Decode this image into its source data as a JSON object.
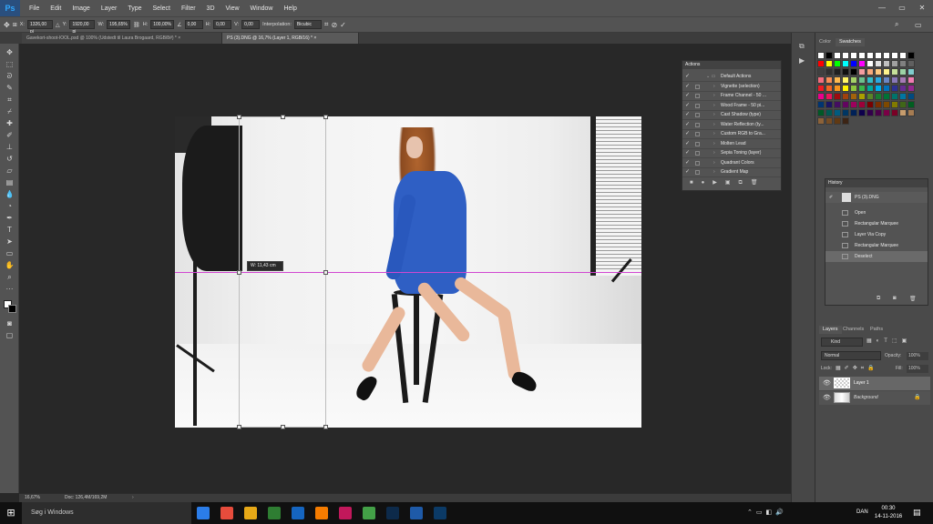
{
  "app": {
    "logo": "Ps"
  },
  "menu": [
    "File",
    "Edit",
    "Image",
    "Layer",
    "Type",
    "Select",
    "Filter",
    "3D",
    "View",
    "Window",
    "Help"
  ],
  "window_controls": [
    "—",
    "▭",
    "✕"
  ],
  "options": {
    "x_label": "X:",
    "x_value": "1326,00 pi",
    "y_label": "Y:",
    "y_value": "1920,00 pi",
    "w_label": "W:",
    "w_value": "195,65%",
    "h_label": "H:",
    "h_value": "100,00%",
    "angle_value": "0,00",
    "hskew_label": "H:",
    "hskew_value": "0,00",
    "vskew_label": "V:",
    "vskew_value": "0,00",
    "interp_label": "Interpolation:",
    "interp_value": "Bicubic"
  },
  "tabs": [
    {
      "label": "Gavekort-shoot-IOOL.psd @ 100% (Udstedt til Laura Brogaard, RGB/8#) *  ×"
    },
    {
      "label": "PS (3).DNG @ 16,7% (Layer 1, RGB/16) *  ×"
    }
  ],
  "canvas": {
    "tooltip": "W:  11,43 cm"
  },
  "status": {
    "zoom": "16,67%",
    "doc": "Doc: 126,4M/169,2M"
  },
  "right_panels": {
    "color_tabs": [
      "Color",
      "Swatches"
    ],
    "swatch_colors": [
      "#ffffff",
      "#000000",
      "#ffffff",
      "#ffffff",
      "#ffffff",
      "#ffffff",
      "#ffffff",
      "#ffffff",
      "#ffffff",
      "#ffffff",
      "#ffffff",
      "#000000",
      "#ff0000",
      "#ffff00",
      "#00ff00",
      "#00ffff",
      "#0000ff",
      "#ff00ff",
      "#ffffff",
      "#e0e0e0",
      "#c0c0c0",
      "#a0a0a0",
      "#808080",
      "#606060",
      "#404040",
      "#303030",
      "#202020",
      "#101010",
      "#000000",
      "#f49ca0",
      "#f7a87b",
      "#fcc77f",
      "#fff38c",
      "#c6e09a",
      "#9cd3a5",
      "#7fcdcd",
      "#f26d7d",
      "#f78e56",
      "#fdb94f",
      "#fff568",
      "#a4d168",
      "#6cc08e",
      "#33bcc8",
      "#2ca8e0",
      "#6b86c4",
      "#8978b8",
      "#a67ab5",
      "#f07cb2",
      "#ed1c24",
      "#f26522",
      "#f7941d",
      "#fff200",
      "#8dc63f",
      "#39b54a",
      "#00a99d",
      "#00aeef",
      "#0072bc",
      "#2e3192",
      "#662d91",
      "#92278f",
      "#ec008c",
      "#ed145b",
      "#9e0b0f",
      "#a0410d",
      "#a3620a",
      "#aba000",
      "#598527",
      "#197b30",
      "#007236",
      "#00746b",
      "#0076a3",
      "#004a80",
      "#003471",
      "#1b1464",
      "#440e62",
      "#630460",
      "#9e005d",
      "#9e0039",
      "#790000",
      "#7b2e00",
      "#7d4900",
      "#827b00",
      "#406618",
      "#005e20",
      "#005826",
      "#005952",
      "#005b7f",
      "#003663",
      "#002157",
      "#0d004c",
      "#32004b",
      "#4b0049",
      "#7b0046",
      "#7a0026",
      "#c69c6d",
      "#a67c52",
      "#8c6239",
      "#754c24",
      "#603913",
      "#3c2415"
    ],
    "actions_title": "Actions",
    "actions": [
      {
        "name": "Default Actions",
        "type": "folder"
      },
      {
        "name": "Vignette (selection)"
      },
      {
        "name": "Frame Channel - 50 ..."
      },
      {
        "name": "Wood Frame - 50 pi..."
      },
      {
        "name": "Cast Shadow (type)"
      },
      {
        "name": "Water Reflection (ty..."
      },
      {
        "name": "Custom RGB to Gra..."
      },
      {
        "name": "Molten Lead"
      },
      {
        "name": "Sepia Toning (layer)"
      },
      {
        "name": "Quadrant Colors"
      },
      {
        "name": "Gradient Map"
      }
    ],
    "history_title": "History",
    "history_snapshot": "PS (3).DNG",
    "history": [
      "Open",
      "Rectangular Marquee",
      "Layer Via Copy",
      "Rectangular Marquee",
      "Deselect"
    ],
    "layers_tabs": [
      "Layers",
      "Channels",
      "Paths"
    ],
    "layers_kind": "Kind",
    "blend_mode": "Normal",
    "opacity_label": "Opacity:",
    "opacity_value": "100%",
    "lock_label": "Lock:",
    "fill_label": "Fill:",
    "fill_value": "100%",
    "layers": [
      {
        "name": "Layer 1"
      },
      {
        "name": "Background"
      }
    ]
  },
  "taskbar": {
    "search": "Søg i Windows",
    "lang": "DAN",
    "time": "00:30",
    "date": "14-11-2016",
    "app_colors": [
      "#2b7de9",
      "#e74c3c",
      "#e6a817",
      "#2e7d32",
      "#1565c0",
      "#f57c00",
      "#c2185b",
      "#43a047",
      "#0d2a4a",
      "#1e5aa8",
      "#0b3a66"
    ]
  }
}
